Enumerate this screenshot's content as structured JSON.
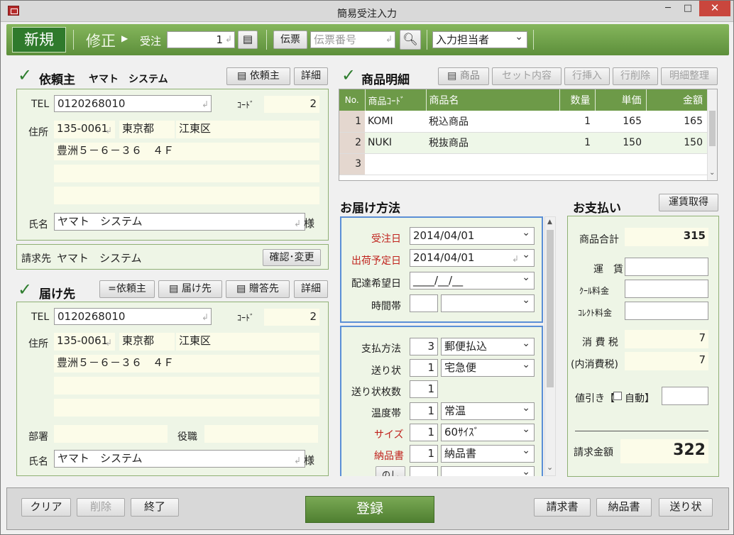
{
  "window": {
    "title": "簡易受注入力",
    "minimize": "─",
    "maximize": "□",
    "close": "✕"
  },
  "toolbar": {
    "new_label": "新規",
    "edit_label": "修正",
    "edit_arrow": "▶",
    "order_label": "受注",
    "order_no": "1",
    "voucher_btn": "伝票",
    "voucher_placeholder": "伝票番号",
    "staff": "入力担当者"
  },
  "requester": {
    "title": "依頼主",
    "name_head": "ヤマト　システム",
    "btn_requester": "依頼主",
    "btn_detail": "詳細",
    "tel_label": "TEL",
    "tel": "0120268010",
    "code_label": "ｺｰﾄﾞ",
    "code": "2",
    "addr_label": "住所",
    "zip": "135-0061",
    "pref": "東京都",
    "city": "江東区",
    "addr1": "豊洲５－６－３６　４Ｆ",
    "addr2": "",
    "addr3": "",
    "name_label": "氏名",
    "name": "ヤマト　システム",
    "honorific": "様",
    "billing_label": "請求先",
    "billing_name": "ヤマト　システム",
    "btn_confirm": "確認･変更"
  },
  "destination": {
    "title": "届け先",
    "btn_eq_requester": "=依頼主",
    "btn_dest": "届け先",
    "btn_gift": "贈答先",
    "btn_detail": "詳細",
    "tel_label": "TEL",
    "tel": "0120268010",
    "code_label": "ｺｰﾄﾞ",
    "code": "2",
    "addr_label": "住所",
    "zip": "135-0061",
    "pref": "東京都",
    "city": "江東区",
    "addr1": "豊洲５－６－３６　４Ｆ",
    "dept_label": "部署",
    "dept": "",
    "post_label": "役職",
    "post": "",
    "name_label": "氏名",
    "name": "ヤマト　システム",
    "honorific": "様"
  },
  "items": {
    "title": "商品明細",
    "btn_product": "商品",
    "btn_set": "セット内容",
    "btn_insert": "行挿入",
    "btn_delete": "行削除",
    "btn_arrange": "明細整理",
    "headers": [
      "No.",
      "商品ｺｰﾄﾞ",
      "商品名",
      "数量",
      "単価",
      "金額"
    ],
    "rows": [
      {
        "no": "1",
        "code": "KOMI",
        "name": "税込商品",
        "qty": "1",
        "price": "165",
        "amount": "165"
      },
      {
        "no": "2",
        "code": "NUKI",
        "name": "税抜商品",
        "qty": "1",
        "price": "150",
        "amount": "150"
      },
      {
        "no": "3",
        "code": "",
        "name": "",
        "qty": "",
        "price": "",
        "amount": ""
      }
    ]
  },
  "delivery": {
    "title": "お届け方法",
    "order_date_label": "受注日",
    "order_date": "2014/04/01",
    "ship_date_label": "出荷予定日",
    "ship_date": "2014/04/01",
    "wish_date_label": "配達希望日",
    "wish_date": "____/__/__",
    "time_label": "時間帯",
    "pay_method_label": "支払方法",
    "pay_method_code": "3",
    "pay_method": "郵便払込",
    "slip_label": "送り状",
    "slip_code": "1",
    "slip": "宅急便",
    "slip_count_label": "送り状枚数",
    "slip_count": "1",
    "temp_label": "温度帯",
    "temp_code": "1",
    "temp": "常温",
    "size_label": "サイズ",
    "size_code": "1",
    "size": "60ｻｲｽﾞ",
    "delivery_note_label": "納品書",
    "delivery_note_code": "1",
    "delivery_note": "納品書",
    "noshi_label": "のし"
  },
  "payment": {
    "title": "お支払い",
    "btn_fare": "運賃取得",
    "subtotal_label": "商品合計",
    "subtotal": "315",
    "fare_label": "運　賃",
    "cool_label": "ｸｰﾙ料金",
    "collect_label": "ｺﾚｸﾄ料金",
    "tax_label": "消 費 税",
    "tax": "7",
    "inner_tax_label": "(内消費税)",
    "inner_tax": "7",
    "discount_label": "値引き【",
    "auto_label": "自動】",
    "total_label": "請求金額",
    "total": "322"
  },
  "footer": {
    "clear": "クリア",
    "delete": "削除",
    "exit": "終了",
    "register": "登録",
    "invoice": "請求書",
    "delivery_note": "納品書",
    "slip": "送り状"
  }
}
